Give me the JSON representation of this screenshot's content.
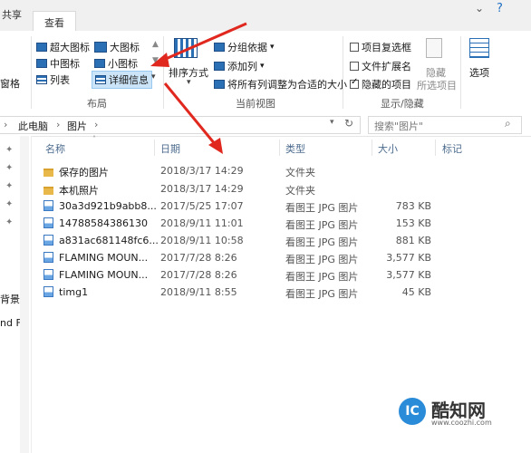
{
  "tabs": [
    "共享",
    "查看"
  ],
  "ribbon": {
    "layout": {
      "options": [
        "超大图标",
        "大图标",
        "中图标",
        "小图标",
        "列表",
        "详细信息"
      ],
      "selected": "详细信息",
      "group_label": "布局"
    },
    "current_view": {
      "sort_label": "排序方式",
      "group_by": "分组依据",
      "add_column": "添加列",
      "fit_columns": "将所有列调整为合适的大小",
      "group_label": "当前视图"
    },
    "show_hide": {
      "item_checkboxes": "项目复选框",
      "file_extensions": "文件扩展名",
      "hidden_items": "隐藏的项目",
      "hide_selected_1": "隐藏",
      "hide_selected_2": "所选项目",
      "options": "选项",
      "group_label": "显示/隐藏"
    },
    "left_partial": "窗格"
  },
  "address": {
    "crumbs": [
      "此电脑",
      "图片"
    ],
    "search_placeholder": "搜索\"图片\""
  },
  "nav_partial": [
    "背景",
    "nd F"
  ],
  "columns": {
    "name": "名称",
    "date": "日期",
    "type": "类型",
    "size": "大小",
    "tags": "标记"
  },
  "files": [
    {
      "name": "保存的图片",
      "date": "2018/3/17 14:29",
      "type": "文件夹",
      "size": "",
      "icon": "folder"
    },
    {
      "name": "本机照片",
      "date": "2018/3/17 14:29",
      "type": "文件夹",
      "size": "",
      "icon": "folder"
    },
    {
      "name": "30a3d921b9abb8...",
      "date": "2017/5/25 17:07",
      "type": "看图王 JPG 图片",
      "size": "783 KB",
      "icon": "image"
    },
    {
      "name": "14788584386130",
      "date": "2018/9/11 11:01",
      "type": "看图王 JPG 图片",
      "size": "153 KB",
      "icon": "image"
    },
    {
      "name": "a831ac681148fc6...",
      "date": "2018/9/11 10:58",
      "type": "看图王 JPG 图片",
      "size": "881 KB",
      "icon": "image"
    },
    {
      "name": "FLAMING MOUN...",
      "date": "2017/7/28 8:26",
      "type": "看图王 JPG 图片",
      "size": "3,577 KB",
      "icon": "image"
    },
    {
      "name": "FLAMING MOUN...",
      "date": "2017/7/28 8:26",
      "type": "看图王 JPG 图片",
      "size": "3,577 KB",
      "icon": "image"
    },
    {
      "name": "timg1",
      "date": "2018/9/11 8:55",
      "type": "看图王 JPG 图片",
      "size": "45 KB",
      "icon": "image"
    }
  ],
  "watermark": {
    "title": "酷知网",
    "url": "www.coozhi.com"
  },
  "colors": {
    "accent": "#2b6fb5",
    "arrow": "#e0281f",
    "selected_bg": "#cce4f7"
  }
}
